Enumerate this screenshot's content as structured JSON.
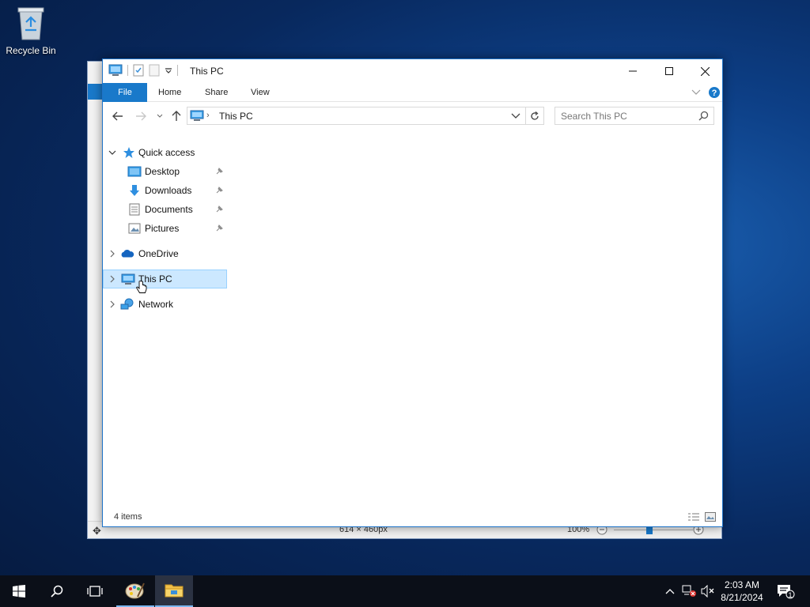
{
  "desktop": {
    "recycle_bin_label": "Recycle Bin"
  },
  "background_window": {
    "status_dimensions": "614 × 460px",
    "zoom_level": "100%"
  },
  "window": {
    "title": "This PC",
    "ribbon_tabs": [
      "File",
      "Home",
      "Share",
      "View"
    ],
    "address_path": "This PC",
    "search_placeholder": "Search This PC",
    "accent_color": "#1979ca"
  },
  "nav_pane": {
    "quick_access": {
      "label": "Quick access",
      "items": [
        {
          "label": "Desktop",
          "icon": "desktop-folder-icon",
          "pinned": true
        },
        {
          "label": "Downloads",
          "icon": "downloads-arrow-icon",
          "pinned": true
        },
        {
          "label": "Documents",
          "icon": "documents-icon",
          "pinned": true
        },
        {
          "label": "Pictures",
          "icon": "pictures-icon",
          "pinned": true
        }
      ]
    },
    "onedrive_label": "OneDrive",
    "this_pc_label": "This PC",
    "network_label": "Network",
    "selected": "This PC"
  },
  "status": {
    "item_count": "4 items"
  },
  "taskbar": {
    "time": "2:03 AM",
    "date": "8/21/2024",
    "notification_count": "1"
  }
}
